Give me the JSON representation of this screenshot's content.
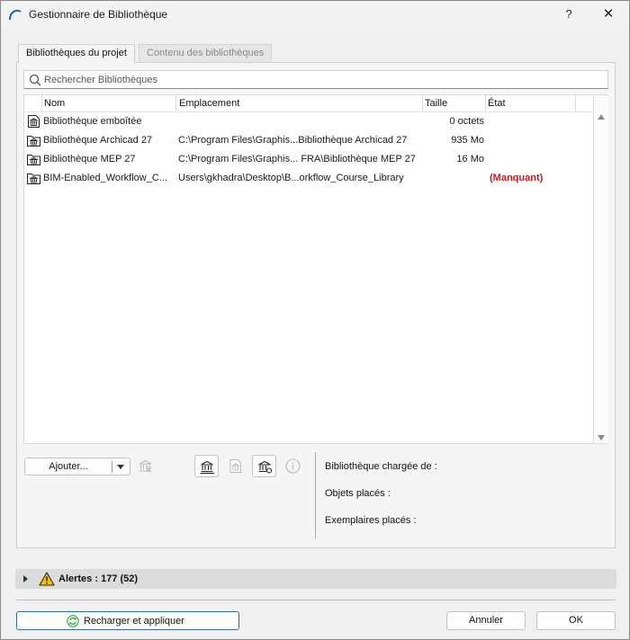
{
  "window": {
    "title": "Gestionnaire de Bibliothèque",
    "help_glyph": "?",
    "close_glyph": "✕",
    "icon": "archicad-arc-icon"
  },
  "tabs": [
    {
      "label": "Bibliothèques du projet",
      "active": true
    },
    {
      "label": "Contenu des bibliothèques",
      "active": false
    }
  ],
  "search": {
    "placeholder": "Rechercher Bibliothèques",
    "value": ""
  },
  "table": {
    "columns": [
      "Nom",
      "Emplacement",
      "Taille",
      "État"
    ],
    "rows": [
      {
        "name": "Bibliothèque emboîtée",
        "location": "",
        "size": "0 octets",
        "state": "",
        "icon": "library-file-icon"
      },
      {
        "name": "Bibliothèque Archicad 27",
        "location": "C:\\Program Files\\Graphis...Bibliothèque Archicad 27",
        "size": "935 Mo",
        "state": "",
        "icon": "library-folder-icon"
      },
      {
        "name": "Bibliothèque MEP 27",
        "location": "C:\\Program Files\\Graphis... FRA\\Bibliothèque MEP 27",
        "size": "16 Mo",
        "state": "",
        "icon": "library-folder-icon"
      },
      {
        "name": "BIM-Enabled_Workflow_C...",
        "location": "Users\\gkhadra\\Desktop\\B...orkflow_Course_Library",
        "size": "",
        "state": "(Manquant)",
        "icon": "library-folder-icon"
      }
    ]
  },
  "toolbar": {
    "add_label": "Ajouter..."
  },
  "info": {
    "loaded_from_label": "Bibliothèque chargée de :",
    "placed_objects_label": "Objets placés :",
    "placed_instances_label": "Exemplaires placés :"
  },
  "alerts": {
    "label": "Alertes : 177 (52)"
  },
  "footer": {
    "reload_label": "Recharger et appliquer",
    "cancel_label": "Annuler",
    "ok_label": "OK"
  },
  "colors": {
    "missing": "#d4151a",
    "accent_border": "#2e6da4",
    "reload_icon": "#2a9d3a",
    "warning": "#f5c400"
  }
}
